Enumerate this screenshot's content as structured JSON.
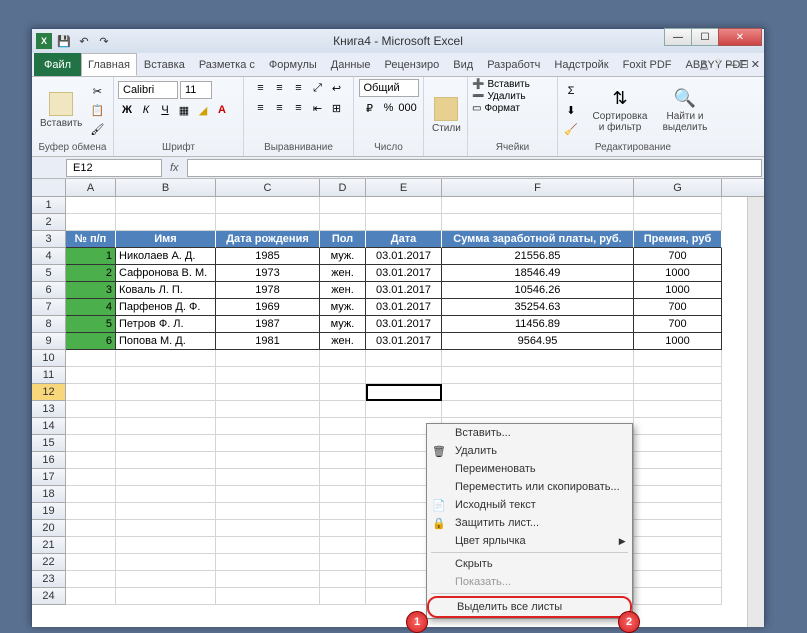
{
  "titlebar": {
    "title": "Книга4 - Microsoft Excel"
  },
  "tabs": {
    "file": "Файл",
    "items": [
      "Главная",
      "Вставка",
      "Разметка с",
      "Формулы",
      "Данные",
      "Рецензиро",
      "Вид",
      "Разработч",
      "Надстройк",
      "Foxit PDF",
      "ABBYY PDF"
    ],
    "active_index": 0
  },
  "ribbon": {
    "clipboard": {
      "label": "Буфер обмена",
      "paste": "Вставить"
    },
    "font": {
      "label": "Шрифт",
      "name": "Calibri",
      "size": "11"
    },
    "alignment": {
      "label": "Выравнивание"
    },
    "number": {
      "label": "Число",
      "format": "Общий"
    },
    "styles": {
      "label": "Стили"
    },
    "cells": {
      "label": "Ячейки",
      "insert": "Вставить",
      "delete": "Удалить",
      "format": "Формат"
    },
    "editing": {
      "label": "Редактирование",
      "sort": "Сортировка и фильтр",
      "find": "Найти и выделить"
    }
  },
  "formula_bar": {
    "name_box": "E12",
    "fx": "fx",
    "value": ""
  },
  "columns": [
    "A",
    "B",
    "C",
    "D",
    "E",
    "F",
    "G"
  ],
  "chart_data": {
    "type": "table",
    "headers": [
      "№ п/п",
      "Имя",
      "Дата рождения",
      "Пол",
      "Дата",
      "Сумма заработной платы, руб.",
      "Премия, руб"
    ],
    "rows": [
      {
        "n": "1",
        "name": "Николаев А. Д.",
        "birth": "1985",
        "sex": "муж.",
        "date": "03.01.2017",
        "salary": "21556.85",
        "bonus": "700"
      },
      {
        "n": "2",
        "name": "Сафронова В. М.",
        "birth": "1973",
        "sex": "жен.",
        "date": "03.01.2017",
        "salary": "18546.49",
        "bonus": "1000"
      },
      {
        "n": "3",
        "name": "Коваль Л. П.",
        "birth": "1978",
        "sex": "жен.",
        "date": "03.01.2017",
        "salary": "10546.26",
        "bonus": "1000"
      },
      {
        "n": "4",
        "name": "Парфенов Д. Ф.",
        "birth": "1969",
        "sex": "муж.",
        "date": "03.01.2017",
        "salary": "35254.63",
        "bonus": "700"
      },
      {
        "n": "5",
        "name": "Петров Ф. Л.",
        "birth": "1987",
        "sex": "муж.",
        "date": "03.01.2017",
        "salary": "11456.89",
        "bonus": "700"
      },
      {
        "n": "6",
        "name": "Попова М. Д.",
        "birth": "1981",
        "sex": "жен.",
        "date": "03.01.2017",
        "salary": "9564.95",
        "bonus": "1000"
      }
    ]
  },
  "visible_rows": 24,
  "selected_row": 12,
  "context_menu": {
    "insert": "Вставить...",
    "delete": "Удалить",
    "rename": "Переименовать",
    "move_copy": "Переместить или скопировать...",
    "view_code": "Исходный текст",
    "protect": "Защитить лист...",
    "tab_color": "Цвет ярлычка",
    "hide": "Скрыть",
    "unhide": "Показать...",
    "select_all": "Выделить все листы"
  },
  "callouts": {
    "one": "1",
    "two": "2"
  }
}
